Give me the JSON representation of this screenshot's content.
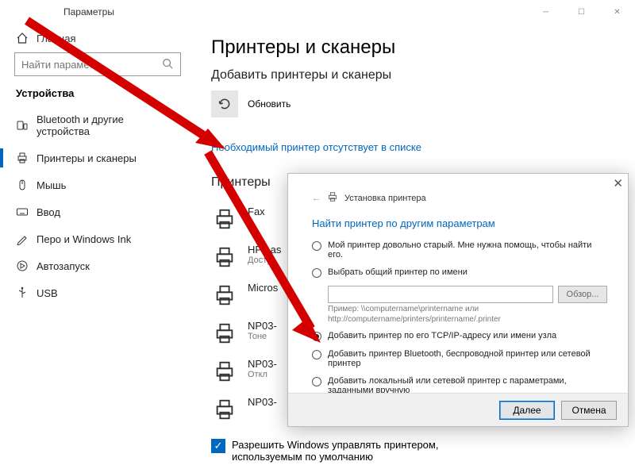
{
  "window": {
    "title": "Параметры"
  },
  "sidebar": {
    "home": "Главная",
    "search_placeholder": "Найти параметр",
    "category": "Устройства",
    "items": [
      {
        "label": "Bluetooth и другие устройства"
      },
      {
        "label": "Принтеры и сканеры"
      },
      {
        "label": "Мышь"
      },
      {
        "label": "Ввод"
      },
      {
        "label": "Перо и Windows Ink"
      },
      {
        "label": "Автозапуск"
      },
      {
        "label": "USB"
      }
    ]
  },
  "main": {
    "page_title": "Принтеры и сканеры",
    "add_section": "Добавить принтеры и сканеры",
    "refresh": "Обновить",
    "missing_link": "Необходимый принтер отсутствует в списке",
    "list_title": "Принтеры",
    "devices": [
      {
        "title": "Fax",
        "sub": ""
      },
      {
        "title": "HP Las",
        "sub": "Досту"
      },
      {
        "title": "Micros",
        "sub": ""
      },
      {
        "title": "NP03-",
        "sub": "Тоне"
      },
      {
        "title": "NP03-",
        "sub": "Откл"
      },
      {
        "title": "NP03-",
        "sub": ""
      }
    ],
    "manage_check": "Разрешить Windows управлять принтером, используемым по умолчанию"
  },
  "dialog": {
    "title": "Установка принтера",
    "heading": "Найти принтер по другим параметрам",
    "options": [
      "Мой принтер довольно старый. Мне нужна помощь, чтобы найти его.",
      "Выбрать общий принтер по имени",
      "Добавить принтер по его TCP/IP-адресу или имени узла",
      "Добавить принтер Bluetooth, беспроводной принтер или сетевой принтер",
      "Добавить локальный или сетевой принтер с параметрами, заданными вручную"
    ],
    "hint_line1": "Пример: \\\\computername\\printername или",
    "hint_line2": "http://computername/printers/printername/.printer",
    "browse": "Обзор...",
    "next": "Далее",
    "cancel": "Отмена"
  }
}
